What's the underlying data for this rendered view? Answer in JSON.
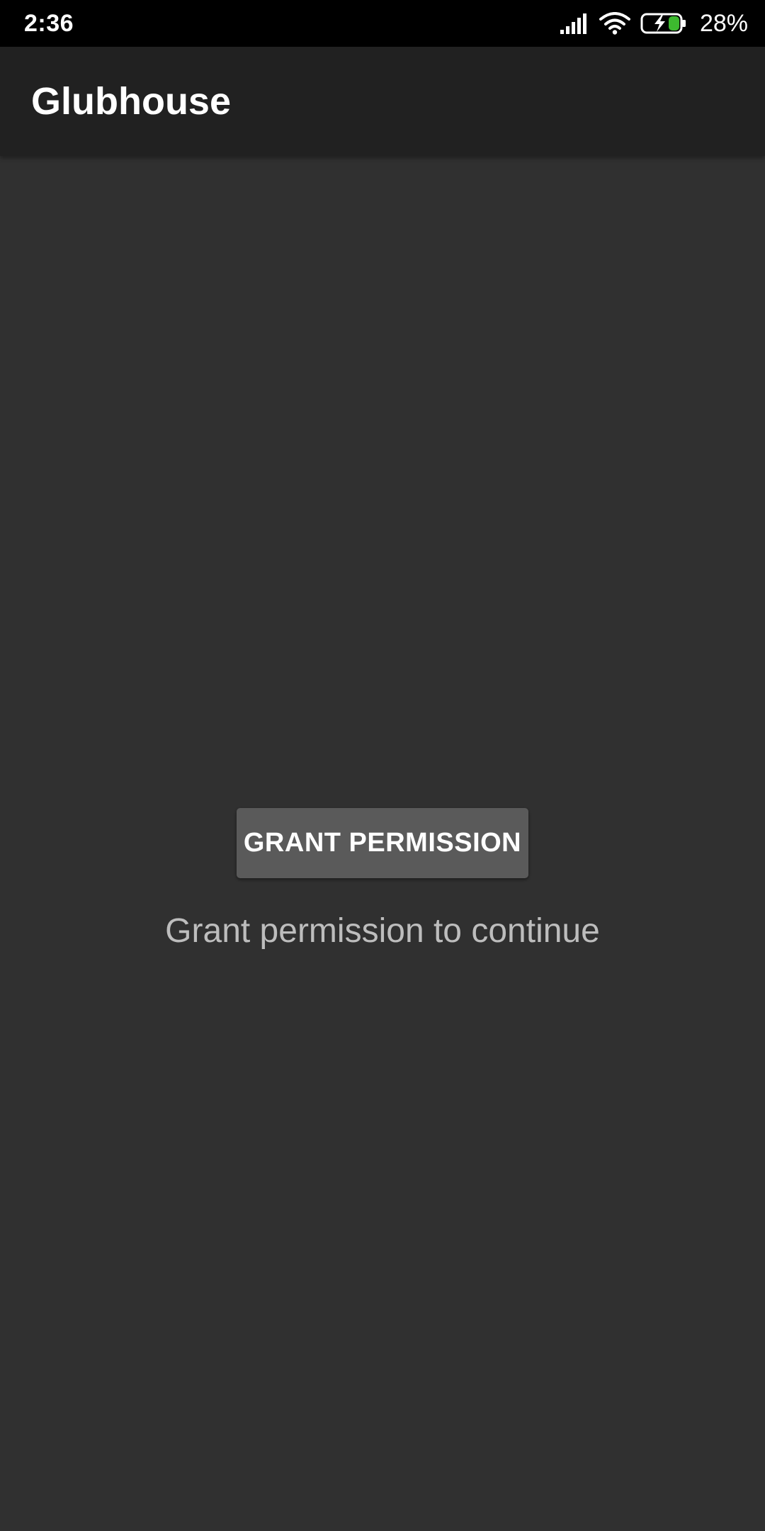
{
  "status_bar": {
    "time": "2:36",
    "battery_percent": "28%",
    "icons": [
      "signal-icon",
      "wifi-icon",
      "battery-charging-icon"
    ]
  },
  "app_bar": {
    "title": "Glubhouse"
  },
  "main": {
    "grant_button_label": "GRANT PERMISSION",
    "message": "Grant permission to continue"
  },
  "colors": {
    "status_bar_bg": "#000000",
    "app_bar_bg": "#212121",
    "content_bg": "#303030",
    "button_bg": "#5a5a5a",
    "battery_charge": "#3dba2f"
  }
}
